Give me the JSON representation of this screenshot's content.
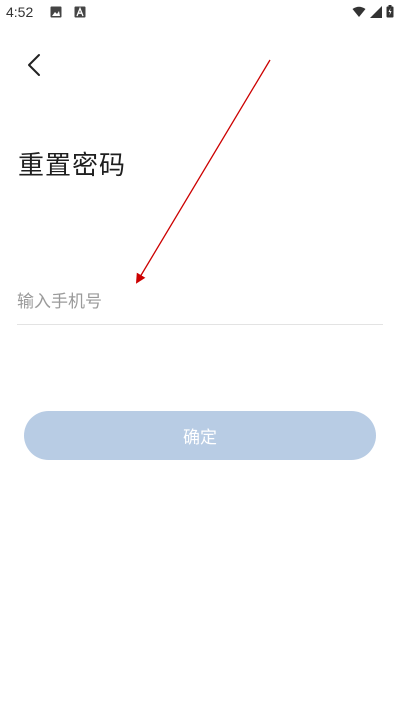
{
  "statusbar": {
    "time": "4:52",
    "icons": [
      "image-icon",
      "a-icon",
      "wifi-icon",
      "signal-icon",
      "battery-icon"
    ]
  },
  "page": {
    "title": "重置密码"
  },
  "form": {
    "phone_placeholder": "输入手机号",
    "confirm_label": "确定"
  },
  "colors": {
    "button_bg": "#b8cce4",
    "annotation_arrow": "#cc0000"
  }
}
